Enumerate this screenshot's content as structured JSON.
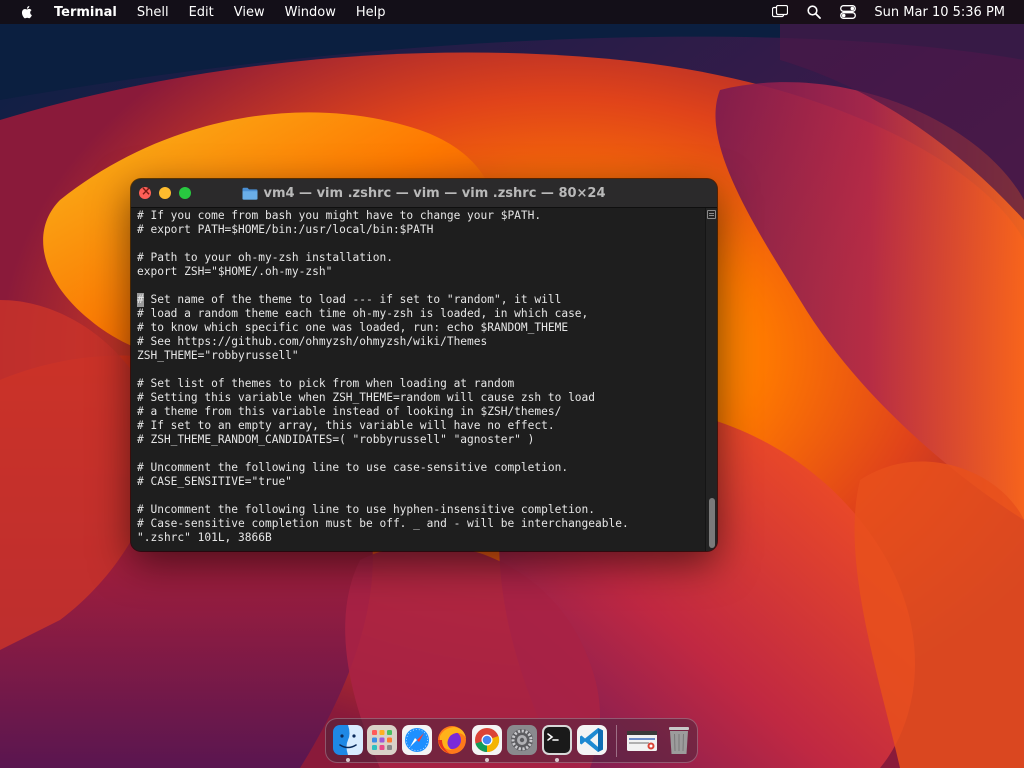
{
  "menubar": {
    "app_name": "Terminal",
    "items": [
      "Shell",
      "Edit",
      "View",
      "Window",
      "Help"
    ],
    "clock": "Sun Mar 10  5:36 PM",
    "status_icons": [
      "screen-mirroring-icon",
      "search-icon",
      "control-center-icon"
    ]
  },
  "window": {
    "title": "vm4 — vim .zshrc — vim — vim .zshrc — 80×24",
    "title_icon": "folder-icon",
    "controls": [
      "close",
      "minimize",
      "zoom"
    ]
  },
  "terminal": {
    "lines": [
      "# If you come from bash you might have to change your $PATH.",
      "# export PATH=$HOME/bin:/usr/local/bin:$PATH",
      "",
      "# Path to your oh-my-zsh installation.",
      "export ZSH=\"$HOME/.oh-my-zsh\"",
      "",
      "# Set name of the theme to load --- if set to \"random\", it will",
      "# load a random theme each time oh-my-zsh is loaded, in which case,",
      "# to know which specific one was loaded, run: echo $RANDOM_THEME",
      "# See https://github.com/ohmyzsh/ohmyzsh/wiki/Themes",
      "ZSH_THEME=\"robbyrussell\"",
      "",
      "# Set list of themes to pick from when loading at random",
      "# Setting this variable when ZSH_THEME=random will cause zsh to load",
      "# a theme from this variable instead of looking in $ZSH/themes/",
      "# If set to an empty array, this variable will have no effect.",
      "# ZSH_THEME_RANDOM_CANDIDATES=( \"robbyrussell\" \"agnoster\" )",
      "",
      "# Uncomment the following line to use case-sensitive completion.",
      "# CASE_SENSITIVE=\"true\"",
      "",
      "# Uncomment the following line to use hyphen-insensitive completion.",
      "# Case-sensitive completion must be off. _ and - will be interchangeable.",
      "\".zshrc\" 101L, 3866B"
    ],
    "cursor_line": 6
  },
  "dock": {
    "items": [
      {
        "name": "finder",
        "icon": "finder-icon",
        "running": true
      },
      {
        "name": "launchpad",
        "icon": "launchpad-icon",
        "running": false
      },
      {
        "name": "safari",
        "icon": "safari-icon",
        "running": false
      },
      {
        "name": "firefox",
        "icon": "firefox-icon",
        "running": false
      },
      {
        "name": "chrome",
        "icon": "chrome-icon",
        "running": true
      },
      {
        "name": "system-settings",
        "icon": "system-settings-icon",
        "running": false
      },
      {
        "name": "terminal",
        "icon": "terminal-icon",
        "running": true
      },
      {
        "name": "vscode",
        "icon": "vscode-icon",
        "running": false
      },
      {
        "name": "downloads",
        "icon": "downloads-stack-icon",
        "running": false
      },
      {
        "name": "trash",
        "icon": "trash-icon",
        "running": false
      }
    ]
  },
  "colors": {
    "terminal_bg": "#1e1e1e",
    "terminal_fg": "#e6e6e6",
    "close": "#ff5f57",
    "minimize": "#febc2e",
    "zoom": "#28c840"
  }
}
